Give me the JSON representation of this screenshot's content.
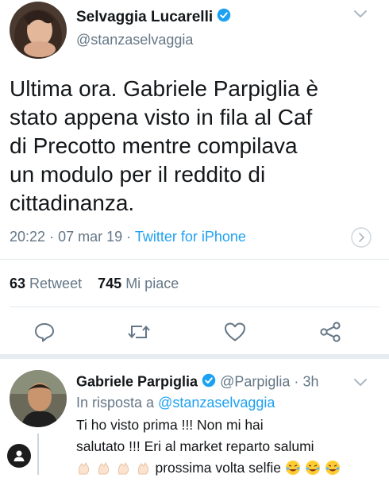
{
  "tweet": {
    "display_name": "Selvaggia Lucarelli",
    "handle": "@stanzaselvaggia",
    "text_lines": [
      "Ultima ora. Gabriele Parpiglia è",
      "stato appena visto in fila al Caf",
      "di Precotto mentre compilava",
      "un modulo per il reddito di",
      "cittadinanza."
    ],
    "time": "20:22",
    "sep1": "·",
    "date": "07 mar 19",
    "sep2": "·",
    "client": "Twitter for iPhone",
    "retweets_count": "63",
    "retweets_label": "Retweet",
    "likes_count": "745",
    "likes_label": "Mi piace"
  },
  "reply": {
    "display_name": "Gabriele Parpiglia",
    "handle": "@Parpiglia",
    "sep": "·",
    "age": "3h",
    "in_reply_prefix": "In risposta a",
    "in_reply_handle": "@stanzaselvaggia",
    "line1": "Ti ho visto prima !!! Non mi hai",
    "line2": "salutato !!! Eri al market reparto salumi",
    "line3_text": "prossima volta selfie"
  },
  "icons": {
    "verified": "verified-badge-icon",
    "chevron": "chevron-down-icon",
    "reply": "reply-icon",
    "retweet": "retweet-icon",
    "like": "heart-icon",
    "share": "share-icon",
    "account": "account-icon"
  },
  "colors": {
    "accent": "#1da1f2",
    "text": "#14171a",
    "muted": "#657786",
    "divider": "#e1e8ed"
  }
}
